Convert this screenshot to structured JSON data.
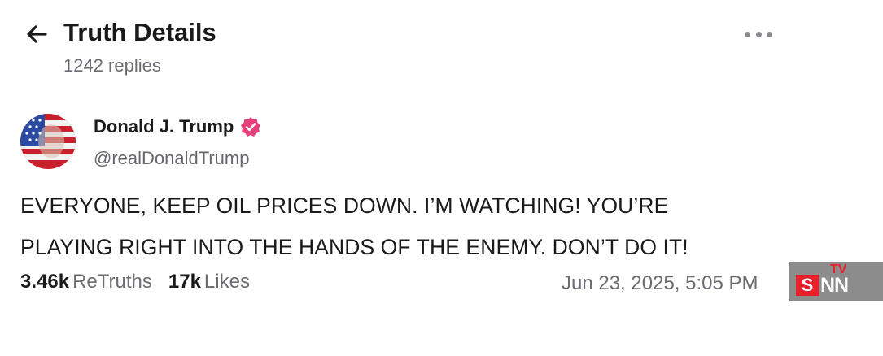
{
  "header": {
    "title": "Truth Details",
    "replies": "1242 replies"
  },
  "post": {
    "author_name": "Donald J. Trump",
    "handle": "@realDonaldTrump",
    "text_line1": "EVERYONE, KEEP OIL PRICES DOWN. I’M WATCHING! YOU’RE",
    "text_line2": "PLAYING RIGHT INTO THE HANDS OF THE ENEMY. DON’T DO IT!",
    "retruths_count": "3.46k",
    "retruths_label": "ReTruths",
    "likes_count": "17k",
    "likes_label": "Likes",
    "timestamp": "Jun 23, 2025, 5:05 PM"
  },
  "watermark": {
    "s": "S",
    "nn": "NN",
    "tv": "TV"
  },
  "colors": {
    "verified": "#e5407a",
    "watermark_bg": "#8c8c8c",
    "watermark_red": "#e8202a"
  },
  "icons": [
    "back-arrow-icon",
    "more-options-icon",
    "verified-badge-icon"
  ]
}
